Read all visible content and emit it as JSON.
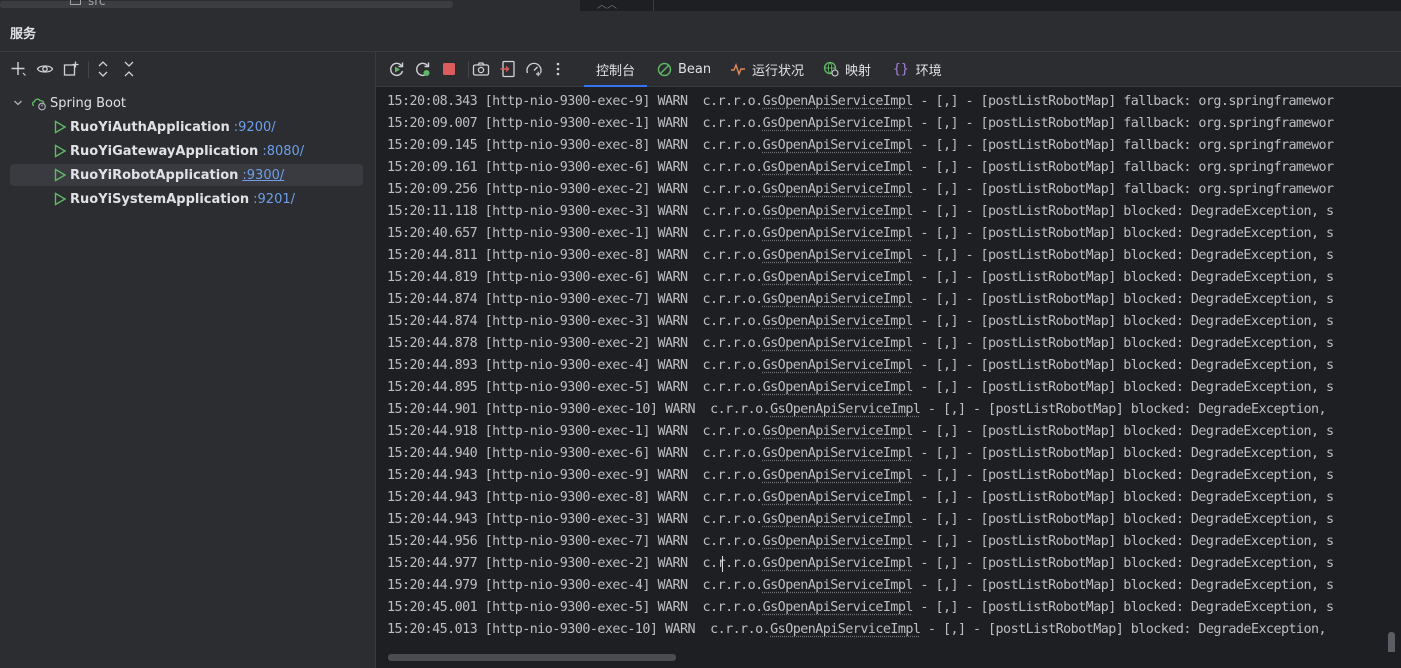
{
  "editor_remnant": {
    "file_label": "src"
  },
  "panel": {
    "title": "服务"
  },
  "left_toolbar": {
    "icons": [
      "add-icon",
      "eye-icon",
      "new-group-icon",
      "expand-all-icon",
      "collapse-all-icon"
    ]
  },
  "tree": {
    "group_label": "Spring Boot",
    "apps": [
      {
        "name": "RuoYiAuthApplication",
        "port": ":9200/",
        "selected": false
      },
      {
        "name": "RuoYiGatewayApplication",
        "port": ":8080/",
        "selected": false
      },
      {
        "name": "RuoYiRobotApplication",
        "port": ":9300/",
        "selected": true
      },
      {
        "name": "RuoYiSystemApplication",
        "port": ":9201/",
        "selected": false
      }
    ]
  },
  "right_toolbar": {
    "icons": [
      "rerun-icon",
      "restart-icon",
      "stop-icon",
      "camera-icon",
      "export-icon",
      "gauge-icon",
      "more-icon"
    ],
    "tabs": [
      {
        "label": "控制台",
        "icon": "",
        "active": true
      },
      {
        "label": "Bean",
        "icon": "bean-icon",
        "active": false
      },
      {
        "label": "运行状况",
        "icon": "health-icon",
        "active": false
      },
      {
        "label": "映射",
        "icon": "mapping-icon",
        "active": false
      },
      {
        "label": "环境",
        "icon": "environment-icon",
        "active": false
      }
    ]
  },
  "console": {
    "lines": [
      {
        "time": "15:20:08.343",
        "thread": "[http-nio-9300-exec-9]",
        "level": "WARN",
        "logger_prefix": "c.r.r.o.",
        "logger_class": "GsOpenApiServiceImpl",
        "message": " - [,] - [postListRobotMap] fallback: org.springframewor"
      },
      {
        "time": "15:20:09.007",
        "thread": "[http-nio-9300-exec-1]",
        "level": "WARN",
        "logger_prefix": "c.r.r.o.",
        "logger_class": "GsOpenApiServiceImpl",
        "message": " - [,] - [postListRobotMap] fallback: org.springframewor"
      },
      {
        "time": "15:20:09.145",
        "thread": "[http-nio-9300-exec-8]",
        "level": "WARN",
        "logger_prefix": "c.r.r.o.",
        "logger_class": "GsOpenApiServiceImpl",
        "message": " - [,] - [postListRobotMap] fallback: org.springframewor"
      },
      {
        "time": "15:20:09.161",
        "thread": "[http-nio-9300-exec-6]",
        "level": "WARN",
        "logger_prefix": "c.r.r.o.",
        "logger_class": "GsOpenApiServiceImpl",
        "message": " - [,] - [postListRobotMap] fallback: org.springframewor"
      },
      {
        "time": "15:20:09.256",
        "thread": "[http-nio-9300-exec-2]",
        "level": "WARN",
        "logger_prefix": "c.r.r.o.",
        "logger_class": "GsOpenApiServiceImpl",
        "message": " - [,] - [postListRobotMap] fallback: org.springframewor"
      },
      {
        "time": "15:20:11.118",
        "thread": "[http-nio-9300-exec-3]",
        "level": "WARN",
        "logger_prefix": "c.r.r.o.",
        "logger_class": "GsOpenApiServiceImpl",
        "message": " - [,] - [postListRobotMap] blocked: DegradeException, s"
      },
      {
        "time": "15:20:40.657",
        "thread": "[http-nio-9300-exec-1]",
        "level": "WARN",
        "logger_prefix": "c.r.r.o.",
        "logger_class": "GsOpenApiServiceImpl",
        "message": " - [,] - [postListRobotMap] blocked: DegradeException, s"
      },
      {
        "time": "15:20:44.811",
        "thread": "[http-nio-9300-exec-8]",
        "level": "WARN",
        "logger_prefix": "c.r.r.o.",
        "logger_class": "GsOpenApiServiceImpl",
        "message": " - [,] - [postListRobotMap] blocked: DegradeException, s"
      },
      {
        "time": "15:20:44.819",
        "thread": "[http-nio-9300-exec-6]",
        "level": "WARN",
        "logger_prefix": "c.r.r.o.",
        "logger_class": "GsOpenApiServiceImpl",
        "message": " - [,] - [postListRobotMap] blocked: DegradeException, s"
      },
      {
        "time": "15:20:44.874",
        "thread": "[http-nio-9300-exec-7]",
        "level": "WARN",
        "logger_prefix": "c.r.r.o.",
        "logger_class": "GsOpenApiServiceImpl",
        "message": " - [,] - [postListRobotMap] blocked: DegradeException, s"
      },
      {
        "time": "15:20:44.874",
        "thread": "[http-nio-9300-exec-3]",
        "level": "WARN",
        "logger_prefix": "c.r.r.o.",
        "logger_class": "GsOpenApiServiceImpl",
        "message": " - [,] - [postListRobotMap] blocked: DegradeException, s"
      },
      {
        "time": "15:20:44.878",
        "thread": "[http-nio-9300-exec-2]",
        "level": "WARN",
        "logger_prefix": "c.r.r.o.",
        "logger_class": "GsOpenApiServiceImpl",
        "message": " - [,] - [postListRobotMap] blocked: DegradeException, s"
      },
      {
        "time": "15:20:44.893",
        "thread": "[http-nio-9300-exec-4]",
        "level": "WARN",
        "logger_prefix": "c.r.r.o.",
        "logger_class": "GsOpenApiServiceImpl",
        "message": " - [,] - [postListRobotMap] blocked: DegradeException, s"
      },
      {
        "time": "15:20:44.895",
        "thread": "[http-nio-9300-exec-5]",
        "level": "WARN",
        "logger_prefix": "c.r.r.o.",
        "logger_class": "GsOpenApiServiceImpl",
        "message": " - [,] - [postListRobotMap] blocked: DegradeException, s"
      },
      {
        "time": "15:20:44.901",
        "thread": "[http-nio-9300-exec-10]",
        "level": "WARN",
        "logger_prefix": "c.r.r.o.",
        "logger_class": "GsOpenApiServiceImpl",
        "message": " - [,] - [postListRobotMap] blocked: DegradeException,"
      },
      {
        "time": "15:20:44.918",
        "thread": "[http-nio-9300-exec-1]",
        "level": "WARN",
        "logger_prefix": "c.r.r.o.",
        "logger_class": "GsOpenApiServiceImpl",
        "message": " - [,] - [postListRobotMap] blocked: DegradeException, s"
      },
      {
        "time": "15:20:44.940",
        "thread": "[http-nio-9300-exec-6]",
        "level": "WARN",
        "logger_prefix": "c.r.r.o.",
        "logger_class": "GsOpenApiServiceImpl",
        "message": " - [,] - [postListRobotMap] blocked: DegradeException, s"
      },
      {
        "time": "15:20:44.943",
        "thread": "[http-nio-9300-exec-9]",
        "level": "WARN",
        "logger_prefix": "c.r.r.o.",
        "logger_class": "GsOpenApiServiceImpl",
        "message": " - [,] - [postListRobotMap] blocked: DegradeException, s"
      },
      {
        "time": "15:20:44.943",
        "thread": "[http-nio-9300-exec-8]",
        "level": "WARN",
        "logger_prefix": "c.r.r.o.",
        "logger_class": "GsOpenApiServiceImpl",
        "message": " - [,] - [postListRobotMap] blocked: DegradeException, s"
      },
      {
        "time": "15:20:44.943",
        "thread": "[http-nio-9300-exec-3]",
        "level": "WARN",
        "logger_prefix": "c.r.r.o.",
        "logger_class": "GsOpenApiServiceImpl",
        "message": " - [,] - [postListRobotMap] blocked: DegradeException, s"
      },
      {
        "time": "15:20:44.956",
        "thread": "[http-nio-9300-exec-7]",
        "level": "WARN",
        "logger_prefix": "c.r.r.o.",
        "logger_class": "GsOpenApiServiceImpl",
        "message": " - [,] - [postListRobotMap] blocked: DegradeException, s"
      },
      {
        "time": "15:20:44.977",
        "thread": "[http-nio-9300-exec-2]",
        "level": "WARN",
        "logger_prefix": "c.r.r.o.",
        "logger_class": "GsOpenApiServiceImpl",
        "message": " - [,] - [postListRobotMap] blocked: DegradeException, s"
      },
      {
        "time": "15:20:44.979",
        "thread": "[http-nio-9300-exec-4]",
        "level": "WARN",
        "logger_prefix": "c.r.r.o.",
        "logger_class": "GsOpenApiServiceImpl",
        "message": " - [,] - [postListRobotMap] blocked: DegradeException, s"
      },
      {
        "time": "15:20:45.001",
        "thread": "[http-nio-9300-exec-5]",
        "level": "WARN",
        "logger_prefix": "c.r.r.o.",
        "logger_class": "GsOpenApiServiceImpl",
        "message": " - [,] - [postListRobotMap] blocked: DegradeException, s"
      },
      {
        "time": "15:20:45.013",
        "thread": "[http-nio-9300-exec-10]",
        "level": "WARN",
        "logger_prefix": "c.r.r.o.",
        "logger_class": "GsOpenApiServiceImpl",
        "message": " - [,] - [postListRobotMap] blocked: DegradeException,"
      }
    ],
    "caret_line": 21
  },
  "colors": {
    "accent": "#3574f0",
    "link": "#6e9ee8",
    "run_icon": "#5fb865",
    "stop_icon": "#db5c5c",
    "panel_bg": "#2b2d30",
    "console_bg": "#1e1f22",
    "selection_bg": "#393b40"
  }
}
